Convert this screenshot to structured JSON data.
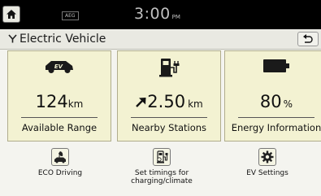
{
  "status": {
    "badge": "AEG",
    "time": "3:00",
    "ampm": "PM"
  },
  "header": {
    "title": "Electric Vehicle"
  },
  "cards": [
    {
      "value": "124",
      "unit": "km",
      "label": "Available Range",
      "icon": "ev-car-icon"
    },
    {
      "value": "2.50",
      "unit": "km",
      "label": "Nearby Stations",
      "icon": "charging-station-icon"
    },
    {
      "value": "80",
      "unit": "%",
      "label": "Energy Information",
      "icon": "battery-icon"
    }
  ],
  "menu": [
    {
      "label": "ECO Driving",
      "icon": "eco-car-icon"
    },
    {
      "label_line1": "Set timings for",
      "label_line2": "charging/climate",
      "icon": "charge-timer-icon"
    },
    {
      "label": "EV Settings",
      "icon": "gear-icon"
    }
  ]
}
